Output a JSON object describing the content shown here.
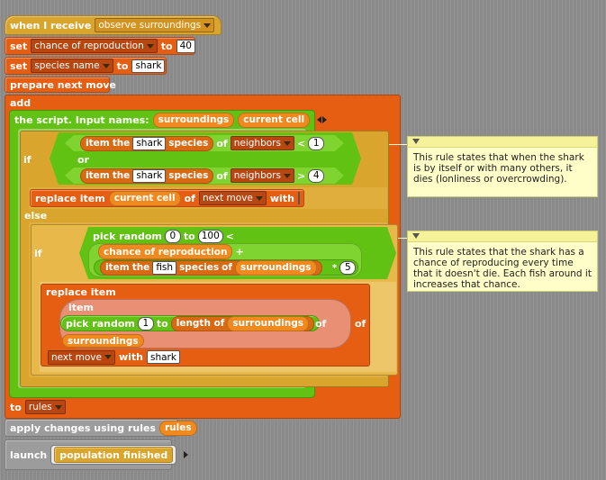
{
  "hat": {
    "label": "when I receive",
    "message": "observe surroundings"
  },
  "set1": {
    "label": "set",
    "var": "chance of reproduction",
    "to": "to",
    "value": "40"
  },
  "set2": {
    "label": "set",
    "var": "species name",
    "to": "to",
    "value": "shark"
  },
  "prepare": {
    "label": "prepare next move"
  },
  "add": {
    "label": "add"
  },
  "script": {
    "label": "the script. Input names:",
    "param1": "surroundings",
    "param2": "current cell"
  },
  "if1": {
    "if_label": "if",
    "item": "item",
    "the": "the",
    "species_word": "species",
    "of": "of",
    "species1": "shark",
    "neighbors1": "neighbors",
    "op1": "<",
    "n1": "1",
    "or": "or",
    "species2": "shark",
    "neighbors2": "neighbors",
    "op2": ">",
    "n2": "4"
  },
  "replace1": {
    "label": "replace item",
    "current": "current cell",
    "of": "of",
    "list": "next move",
    "with": "with",
    "with_value": ""
  },
  "else": {
    "label": "else"
  },
  "if2": {
    "if_label": "if",
    "pick": "pick random",
    "from": "0",
    "to": "to",
    "upto": "100",
    "lt": "<",
    "chance": "chance of reproduction",
    "plus": "+",
    "item": "item",
    "the": "the",
    "species_name": "fish",
    "species_word": "species",
    "of": "of",
    "list": "surroundings",
    "times": "*",
    "mult": "5"
  },
  "replace2": {
    "label": "replace item",
    "item": "item",
    "pick": "pick random",
    "from": "1",
    "to": "to",
    "length": "length of",
    "length_list": "surroundings",
    "of": "of",
    "list": "surroundings",
    "outer_of": "of",
    "target": "next move",
    "with": "with",
    "with_value": "shark"
  },
  "to_rules": {
    "label": "to",
    "value": "rules"
  },
  "apply": {
    "label": "apply changes using rules",
    "value": "rules"
  },
  "launch": {
    "label": "launch",
    "value": "population finished"
  },
  "comment1": {
    "text": "This rule states that when the shark is by itself or with many others, it dies (lonliness or overcrowding)."
  },
  "comment2": {
    "text": "This rule states that the shark has a chance of reproducing every time that it doesn't die.  Each fish around it increases that chance."
  },
  "colors": {
    "control": "#d9a52d",
    "variables": "#e65e11",
    "operators": "#62c213",
    "other": "#9c9c9c",
    "comment": "#fffec8"
  }
}
